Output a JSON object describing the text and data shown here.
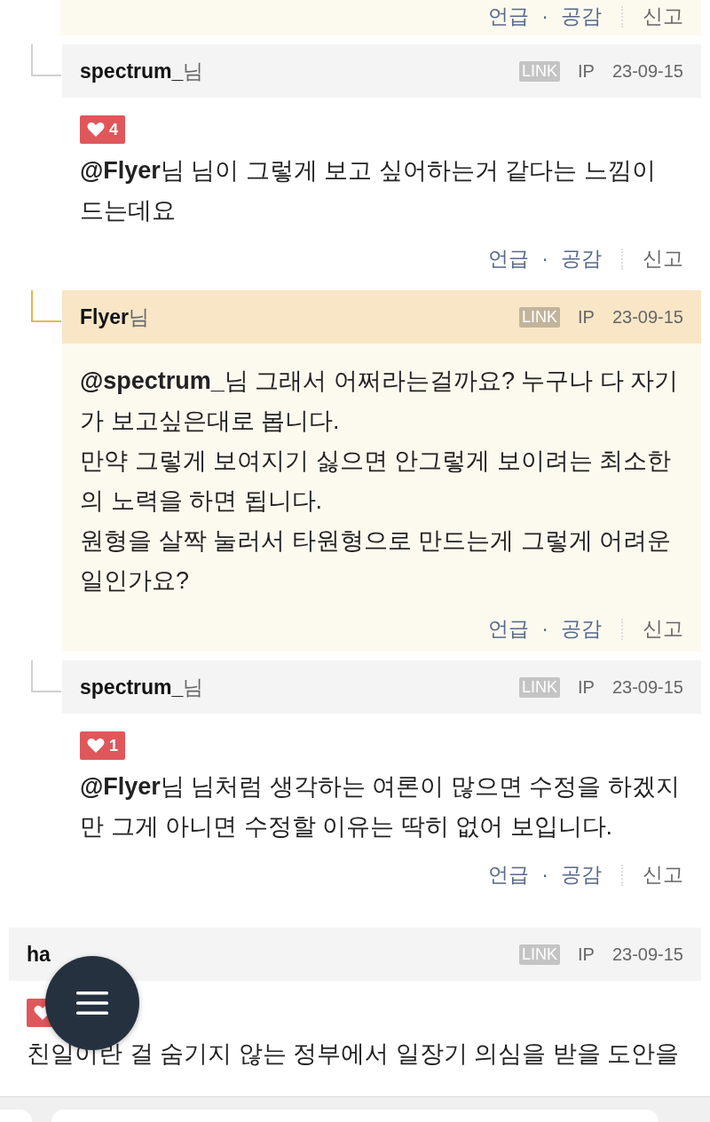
{
  "top_actions": {
    "mention": "언급",
    "separator": "·",
    "like": "공감",
    "report": "신고"
  },
  "comments": [
    {
      "kind": "reply",
      "highlighted": false,
      "author": "spectrum_",
      "suffix": "님",
      "link": "LINK",
      "ip": "IP",
      "date": "23-09-15",
      "has_likes": true,
      "likes": "4",
      "paragraphs": [
        "**@Flyer**님 님이 그렇게 보고 싶어하는거 같다는 느낌이 드는데요"
      ],
      "actions": {
        "mention": "언급",
        "separator": "·",
        "like": "공감",
        "report": "신고"
      }
    },
    {
      "kind": "reply",
      "highlighted": true,
      "author": "Flyer",
      "suffix": "님",
      "link": "LINK",
      "ip": "IP",
      "date": "23-09-15",
      "has_likes": false,
      "paragraphs": [
        "**@spectrum_**님 그래서 어쩌라는걸까요? 누구나 다 자기가 보고싶은대로 봅니다.",
        "만약 그렇게 보여지기 싫으면 안그렇게 보이려는 최소한의 노력을 하면 됩니다.",
        "원형을 살짝 눌러서 타원형으로 만드는게 그렇게 어려운 일인가요?"
      ],
      "actions": {
        "mention": "언급",
        "separator": "·",
        "like": "공감",
        "report": "신고"
      }
    },
    {
      "kind": "reply",
      "highlighted": false,
      "author": "spectrum_",
      "suffix": "님",
      "link": "LINK",
      "ip": "IP",
      "date": "23-09-15",
      "has_likes": true,
      "likes": "1",
      "paragraphs": [
        "**@Flyer**님 님처럼 생각하는 여론이 많으면 수정을 하겠지만 그게 아니면 수정할 이유는 딱히 없어 보입니다."
      ],
      "actions": {
        "mention": "언급",
        "separator": "·",
        "like": "공감",
        "report": "신고"
      }
    },
    {
      "kind": "root",
      "highlighted": false,
      "author": "ha",
      "link": "LINK",
      "ip": "IP",
      "date": "23-09-15",
      "has_likes": true,
      "paragraphs": [
        "친일이란 걸 숨기지 않는 정부에서 일장기 의심을 받을 도안을"
      ]
    }
  ]
}
